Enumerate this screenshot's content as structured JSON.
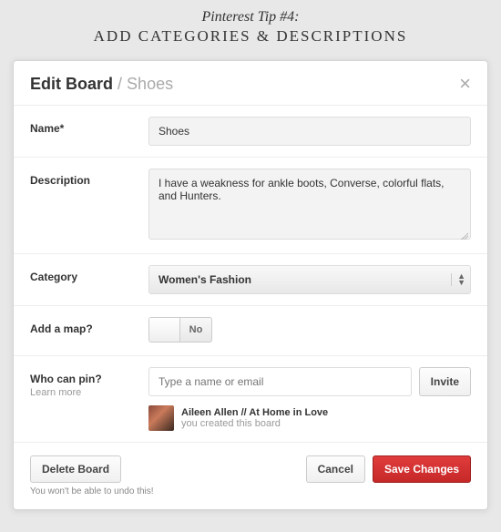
{
  "header": {
    "tip_line": "Pinterest Tip #4:",
    "title": "ADD CATEGORIES & DESCRIPTIONS"
  },
  "modal": {
    "title_prefix": "Edit Board",
    "title_board": "Shoes",
    "close_glyph": "×"
  },
  "name": {
    "label": "Name*",
    "value": "Shoes"
  },
  "description": {
    "label": "Description",
    "value": "I have a weakness for ankle boots, Converse, colorful flats, and Hunters."
  },
  "category": {
    "label": "Category",
    "selected": "Women's Fashion"
  },
  "map": {
    "label": "Add a map?",
    "no_label": "No"
  },
  "pin": {
    "label": "Who can pin?",
    "learn_more": "Learn more",
    "placeholder": "Type a name or email",
    "invite_label": "Invite",
    "collab_name": "Aileen Allen // At Home in Love",
    "collab_sub": "you created this board"
  },
  "footer": {
    "delete_label": "Delete Board",
    "warn": "You won't be able to undo this!",
    "cancel_label": "Cancel",
    "save_label": "Save Changes"
  }
}
